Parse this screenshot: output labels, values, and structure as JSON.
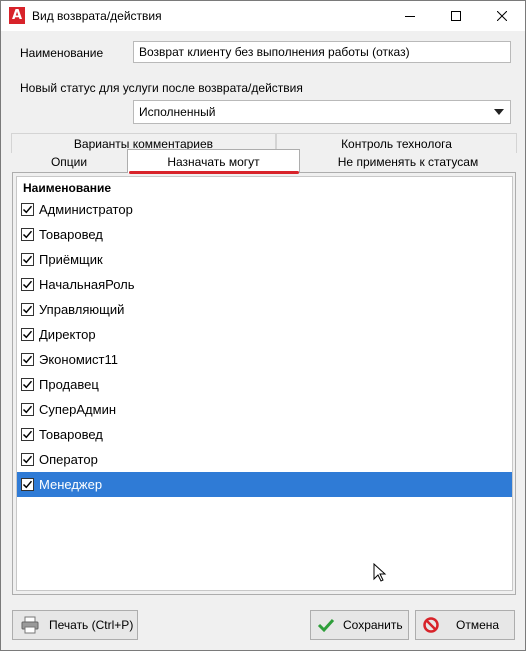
{
  "window": {
    "title": "Вид возврата/действия",
    "app_icon_letter": "A"
  },
  "form": {
    "name_label": "Наименование",
    "name_value": "Возврат клиенту без выполнения работы (отказ)",
    "status_label": "Новый статус для услуги после возврата/действия",
    "status_value": "Исполненный"
  },
  "tabs": {
    "row1": [
      {
        "label": "Варианты комментариев"
      },
      {
        "label": "Контроль технолога"
      }
    ],
    "row2": [
      {
        "label": "Опции"
      },
      {
        "label": "Назначать могут",
        "active": true
      },
      {
        "label": "Не применять к статусам"
      }
    ],
    "accent_color": "#d8232a"
  },
  "grid": {
    "header": "Наименование",
    "rows": [
      {
        "label": "Администратор",
        "checked": true
      },
      {
        "label": "Товаровед",
        "checked": true
      },
      {
        "label": "Приёмщик",
        "checked": true
      },
      {
        "label": "НачальнаяРоль",
        "checked": true
      },
      {
        "label": "Управляющий",
        "checked": true
      },
      {
        "label": "Директор",
        "checked": true
      },
      {
        "label": "Экономист11",
        "checked": true
      },
      {
        "label": "Продавец",
        "checked": true
      },
      {
        "label": "СуперАдмин",
        "checked": true
      },
      {
        "label": "Товаровед",
        "checked": true
      },
      {
        "label": "Оператор",
        "checked": true
      },
      {
        "label": "Менеджер",
        "checked": true,
        "selected": true
      }
    ],
    "selection_color": "#2f7bd6"
  },
  "buttons": {
    "print": {
      "label": "Печать (Ctrl+P)",
      "icon": "printer-icon"
    },
    "save": {
      "label": "Сохранить",
      "icon": "checkmark-icon"
    },
    "cancel": {
      "label": "Отмена",
      "icon": "no-entry-icon"
    }
  }
}
